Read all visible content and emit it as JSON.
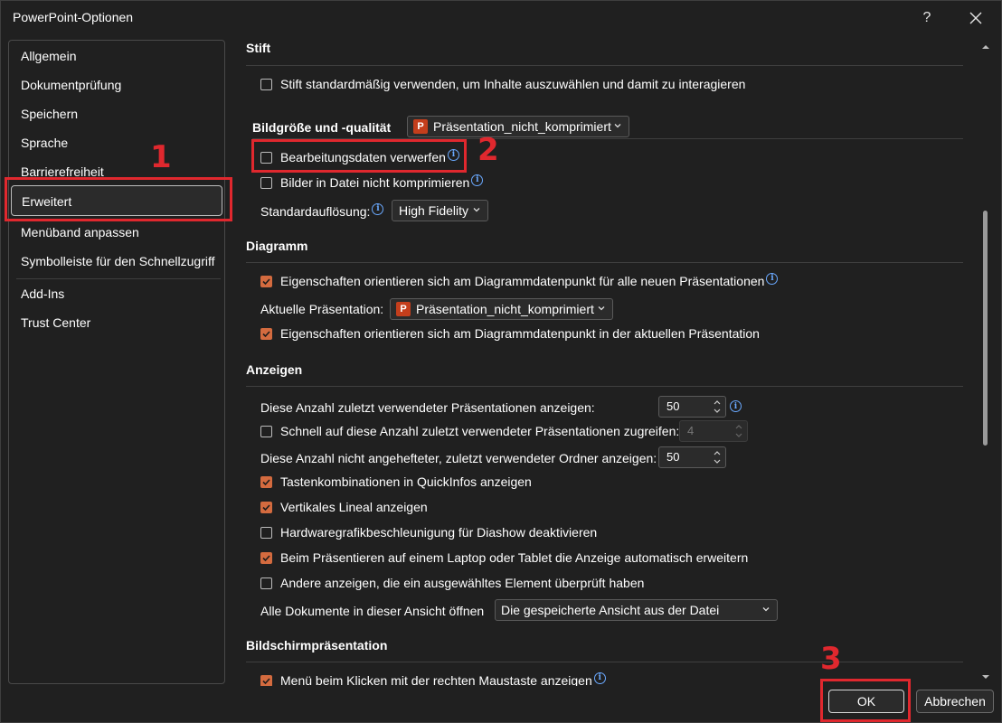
{
  "window": {
    "title": "PowerPoint-Optionen",
    "help_label": "?",
    "close_icon": "close-icon"
  },
  "sidebar": {
    "items": [
      {
        "label": "Allgemein"
      },
      {
        "label": "Dokumentprüfung"
      },
      {
        "label": "Speichern"
      },
      {
        "label": "Sprache"
      },
      {
        "label": "Barrierefreiheit"
      },
      {
        "label": "Erweitert",
        "selected": true
      },
      {
        "label": "Menüband anpassen"
      },
      {
        "label": "Symbolleiste für den Schnellzugriff"
      },
      {
        "label": "Add-Ins"
      },
      {
        "label": "Trust Center"
      }
    ]
  },
  "stift": {
    "heading": "Stift",
    "use_pen": {
      "label": "Stift standardmäßig verwenden, um Inhalte auszuwählen und damit zu interagieren",
      "checked": false
    }
  },
  "bild": {
    "heading": "Bildgröße und -qualität",
    "file_combo": "Präsentation_nicht_komprimiert",
    "discard": {
      "label": "Bearbeitungsdaten verwerfen",
      "checked": false
    },
    "no_compress": {
      "label": "Bilder in Datei nicht komprimieren",
      "checked": false
    },
    "resolution_label": "Standardauflösung:",
    "resolution_value": "High Fidelity"
  },
  "diagramm": {
    "heading": "Diagramm",
    "props_new": {
      "label": "Eigenschaften orientieren sich am Diagrammdatenpunkt für alle neuen Präsentationen",
      "checked": true
    },
    "current_label": "Aktuelle Präsentation:",
    "current_value": "Präsentation_nicht_komprimiert",
    "props_current": {
      "label": "Eigenschaften orientieren sich am Diagrammdatenpunkt in der aktuellen Präsentation",
      "checked": true
    }
  },
  "anzeigen": {
    "heading": "Anzeigen",
    "recent_label": "Diese Anzahl zuletzt verwendeter Präsentationen anzeigen:",
    "recent_value": "50",
    "quick": {
      "label": "Schnell auf diese Anzahl zuletzt verwendeter Präsentationen zugreifen:",
      "checked": false
    },
    "quick_value": "4",
    "folders_label": "Diese Anzahl nicht angehefteter, zuletzt verwendeter Ordner anzeigen:",
    "folders_value": "50",
    "shortcuts": {
      "label": "Tastenkombinationen in QuickInfos anzeigen",
      "checked": true
    },
    "ruler": {
      "label": "Vertikales Lineal anzeigen",
      "checked": true
    },
    "hwaccel": {
      "label": "Hardwaregrafikbeschleunigung für Diashow deaktivieren",
      "checked": false
    },
    "laptop": {
      "label": "Beim Präsentieren auf einem Laptop oder Tablet die Anzeige automatisch erweitern",
      "checked": true
    },
    "others": {
      "label": "Andere anzeigen, die ein ausgewähltes Element überprüft haben",
      "checked": false
    },
    "open_label": "Alle Dokumente in dieser Ansicht öffnen",
    "open_value": "Die gespeicherte Ansicht aus der Datei"
  },
  "bildschirm": {
    "heading": "Bildschirmpräsentation",
    "context_menu": {
      "label": "Menü beim Klicken mit der rechten Maustaste anzeigen",
      "checked": true
    }
  },
  "annotations": {
    "n1": "1",
    "n2": "2",
    "n3": "3"
  },
  "footer": {
    "ok_label": "OK",
    "cancel_label": "Abbrechen"
  },
  "colors": {
    "accent_checkbox": "#d46b3f",
    "annotation_red": "#e0282e",
    "info_blue": "#6aa9ff"
  }
}
